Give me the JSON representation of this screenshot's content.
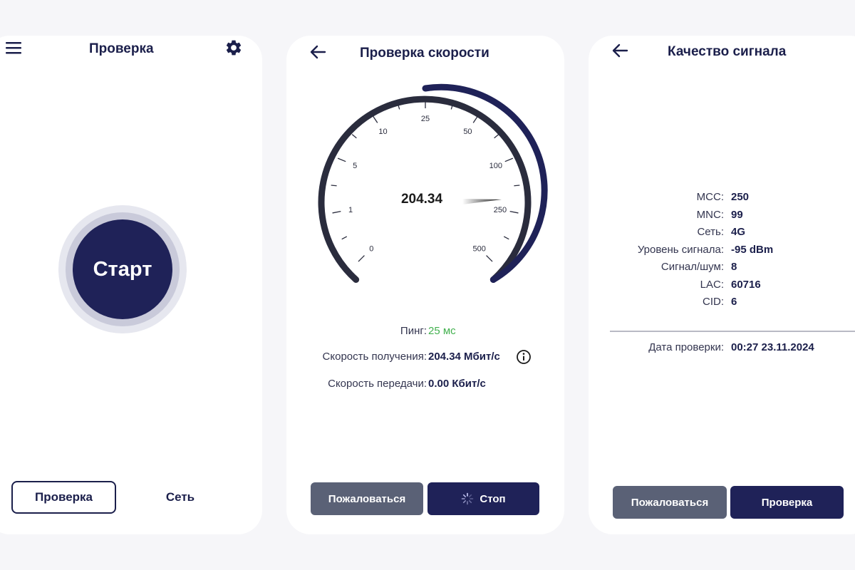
{
  "check_screen": {
    "title": "Проверка",
    "start_label": "Старт",
    "tabs": [
      {
        "label": "Проверка",
        "active": true
      },
      {
        "label": "Сеть",
        "active": false
      }
    ]
  },
  "speed_screen": {
    "title": "Проверка скорости",
    "gauge": {
      "value_text": "204.34",
      "value": 204.34,
      "scale_labels": [
        "0",
        "1",
        "5",
        "10",
        "25",
        "50",
        "100",
        "250",
        "500"
      ]
    },
    "ping_label": "Пинг:",
    "ping_value": "25 мс",
    "download_label": "Скорость получения:",
    "download_value": "204.34 Мбит/с",
    "upload_label": "Скорость передачи:",
    "upload_value": "0.00 Кбит/с",
    "complain_label": "Пожаловаться",
    "stop_label": "Стоп"
  },
  "signal_screen": {
    "title": "Качество сигнала",
    "rows": [
      {
        "label": "MCC:",
        "value": "250",
        "highlight": false
      },
      {
        "label": "MNC:",
        "value": "99",
        "highlight": false
      },
      {
        "label": "Сеть:",
        "value": "4G",
        "highlight": false
      },
      {
        "label": "Уровень сигнала:",
        "value": "-95 dBm",
        "highlight": true
      },
      {
        "label": "Сигнал/шум:",
        "value": "8",
        "highlight": false
      },
      {
        "label": "LAC:",
        "value": "60716",
        "highlight": false
      },
      {
        "label": "CID:",
        "value": "6",
        "highlight": false
      }
    ],
    "date_label": "Дата проверки:",
    "date_value": "00:27 23.11.2024",
    "complain_label": "Пожаловаться",
    "check_label": "Проверка"
  },
  "colors": {
    "navy": "#1f2258",
    "grey_button": "#5a6176",
    "green": "#43b14f",
    "background": "#f6f6f9"
  },
  "icons": {
    "menu": "menu-icon",
    "settings": "gear-icon",
    "back": "arrow-left-icon",
    "info": "info-icon",
    "spinner": "spinner-icon"
  }
}
